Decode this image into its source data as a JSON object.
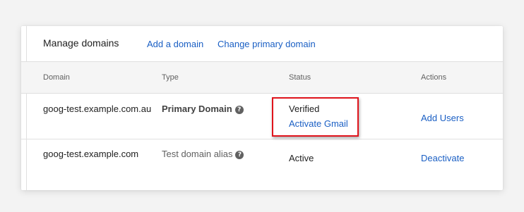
{
  "header": {
    "title": "Manage domains",
    "add_domain_label": "Add a domain",
    "change_primary_label": "Change primary domain"
  },
  "columns": {
    "domain": "Domain",
    "type": "Type",
    "status": "Status",
    "actions": "Actions"
  },
  "rows": [
    {
      "domain": "goog-test.example.com.au",
      "type": "Primary Domain",
      "status": "Verified",
      "status_link": "Activate Gmail",
      "action": "Add Users"
    },
    {
      "domain": "goog-test.example.com",
      "type": "Test domain alias",
      "status": "Active",
      "action": "Deactivate"
    }
  ],
  "icons": {
    "help": "help-circle-icon"
  },
  "colors": {
    "link": "#1a5fc4",
    "highlight": "#e0141c"
  }
}
